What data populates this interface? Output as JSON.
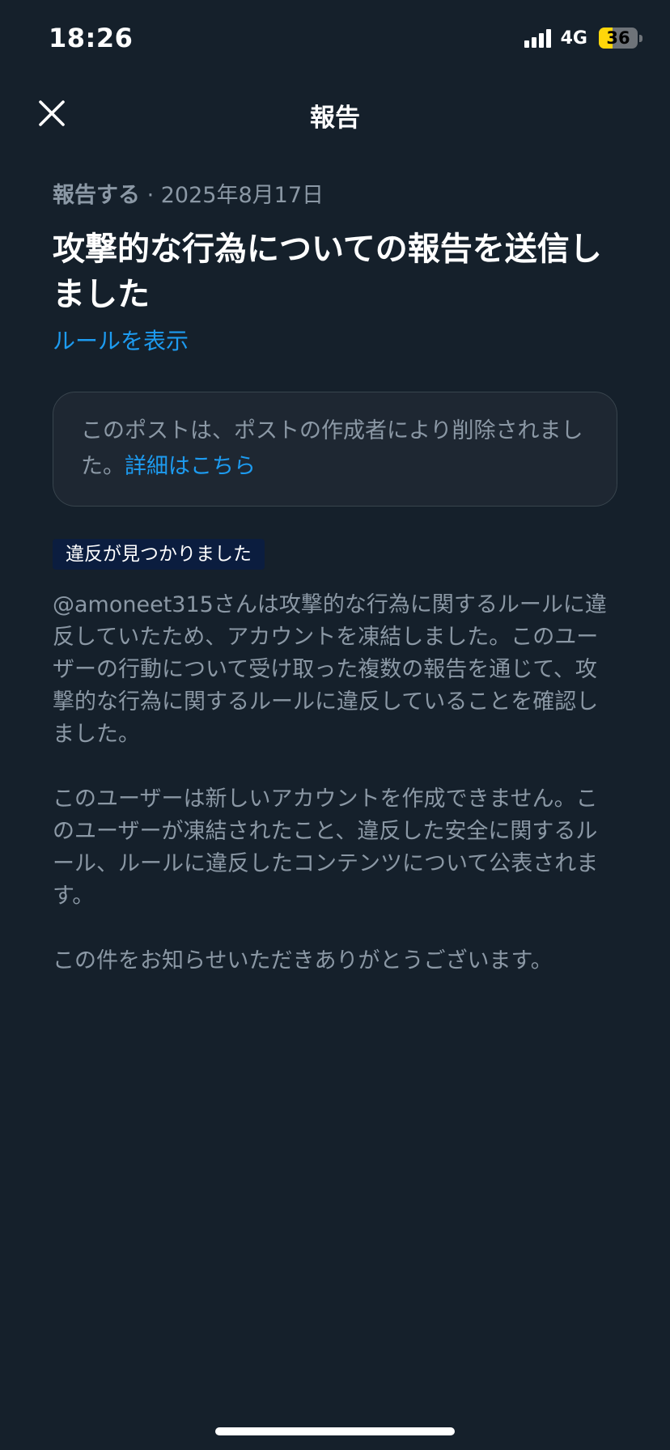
{
  "status_bar": {
    "time": "18:26",
    "network": "4G",
    "battery": "36",
    "battery_level": 0.36,
    "battery_color": "#ffd60a"
  },
  "header": {
    "title": "報告",
    "close_icon": "close-icon"
  },
  "report": {
    "label": "報告する",
    "separator": " · ",
    "date": "2025年8月17日",
    "title": "攻撃的な行為についての報告を送信しました",
    "rules_link": "ルールを表示"
  },
  "deleted_notice": {
    "text": "このポストは、ポストの作成者により削除されました。",
    "link": "詳細はこちら"
  },
  "badge": "違反が見つかりました",
  "paragraphs": [
    "@amoneet315さんは攻撃的な行為に関するルールに違反していたため、アカウントを凍結しました。このユーザーの行動について受け取った複数の報告を通じて、攻撃的な行為に関するルールに違反していることを確認しました。",
    "このユーザーは新しいアカウントを作成できません。このユーザーが凍結されたこと、違反した安全に関するルール、ルールに違反したコンテンツについて公表されます。",
    "この件をお知らせいただきありがとうございます。"
  ],
  "colors": {
    "background": "#15202b",
    "accent": "#1d9bf0",
    "secondary_text": "#8b98a5",
    "badge_background": "#0b1d3f"
  }
}
